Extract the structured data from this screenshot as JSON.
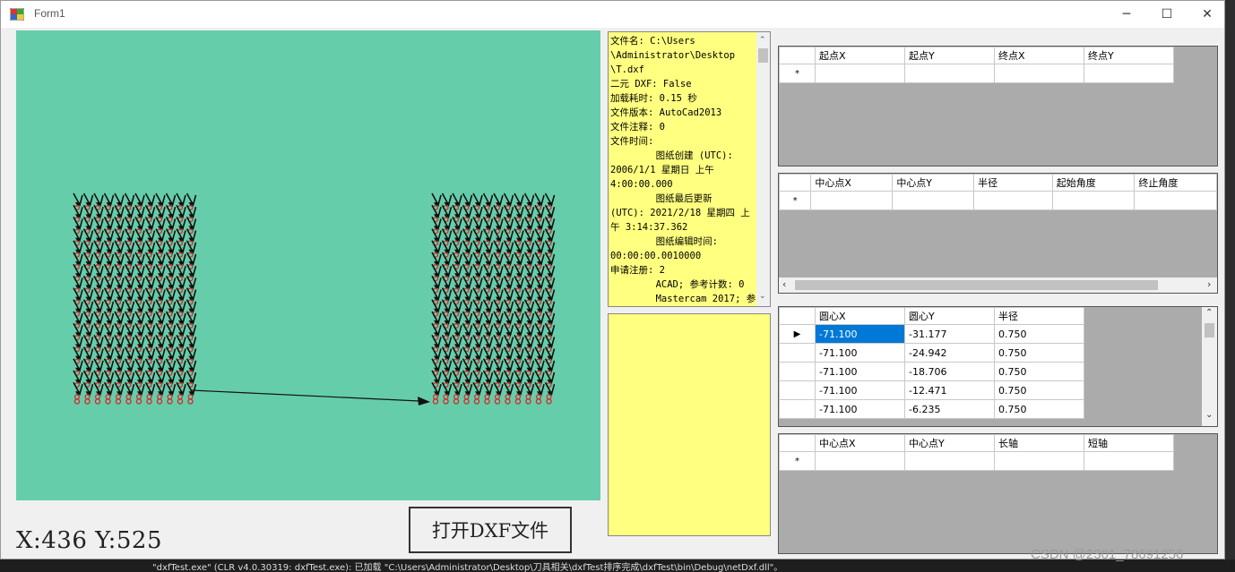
{
  "window": {
    "title": "Form1"
  },
  "status": {
    "coords": "X:436  Y:525"
  },
  "buttons": {
    "open_dxf": "打开DXF文件"
  },
  "info_text": "文件名: C:\\Users\n\\Administrator\\Desktop\n\\T.dxf\n二元 DXF: False\n加载耗时: 0.15 秒\n文件版本: AutoCad2013\n文件注释: 0\n文件时间:\n        图纸创建 (UTC):\n2006/1/1 星期日 上午\n4:00:00.000\n        图纸最后更新\n(UTC): 2021/2/18 星期四 上\n午 3:14:37.362\n        图纸编辑时间:\n00:00:00.0010000\n申请注册: 2\n        ACAD; 参考计数: 0\n        Mastercam 2017; 参",
  "grids": {
    "lines": {
      "headers": [
        "起点X",
        "起点Y",
        "终点X",
        "终点Y"
      ],
      "new_row_marker": "*"
    },
    "arcs": {
      "headers": [
        "中心点X",
        "中心点Y",
        "半径",
        "起始角度",
        "终止角度"
      ],
      "new_row_marker": "*"
    },
    "circles": {
      "headers": [
        "圆心X",
        "圆心Y",
        "半径"
      ],
      "current_row_marker": "▶",
      "rows": [
        [
          "-71.100",
          "-31.177",
          "0.750"
        ],
        [
          "-71.100",
          "-24.942",
          "0.750"
        ],
        [
          "-71.100",
          "-18.706",
          "0.750"
        ],
        [
          "-71.100",
          "-12.471",
          "0.750"
        ],
        [
          "-71.100",
          "-6.235",
          "0.750"
        ]
      ]
    },
    "ellipses": {
      "headers": [
        "中心点X",
        "中心点Y",
        "长轴",
        "短轴"
      ],
      "new_row_marker": "*"
    }
  },
  "colors": {
    "canvas_bg": "#66cdaa",
    "info_bg": "#ffff80",
    "selection": "#0078d7"
  },
  "bottom_text": "\"dxfTest.exe\" (CLR v4.0.30319: dxfTest.exe): 已加载 \"C:\\Users\\Administrator\\Desktop\\刀具相关\\dxfTest排序完成\\dxfTest\\bin\\Debug\\netDxf.dll\"。",
  "watermark": "CSDN @2301_78691256"
}
